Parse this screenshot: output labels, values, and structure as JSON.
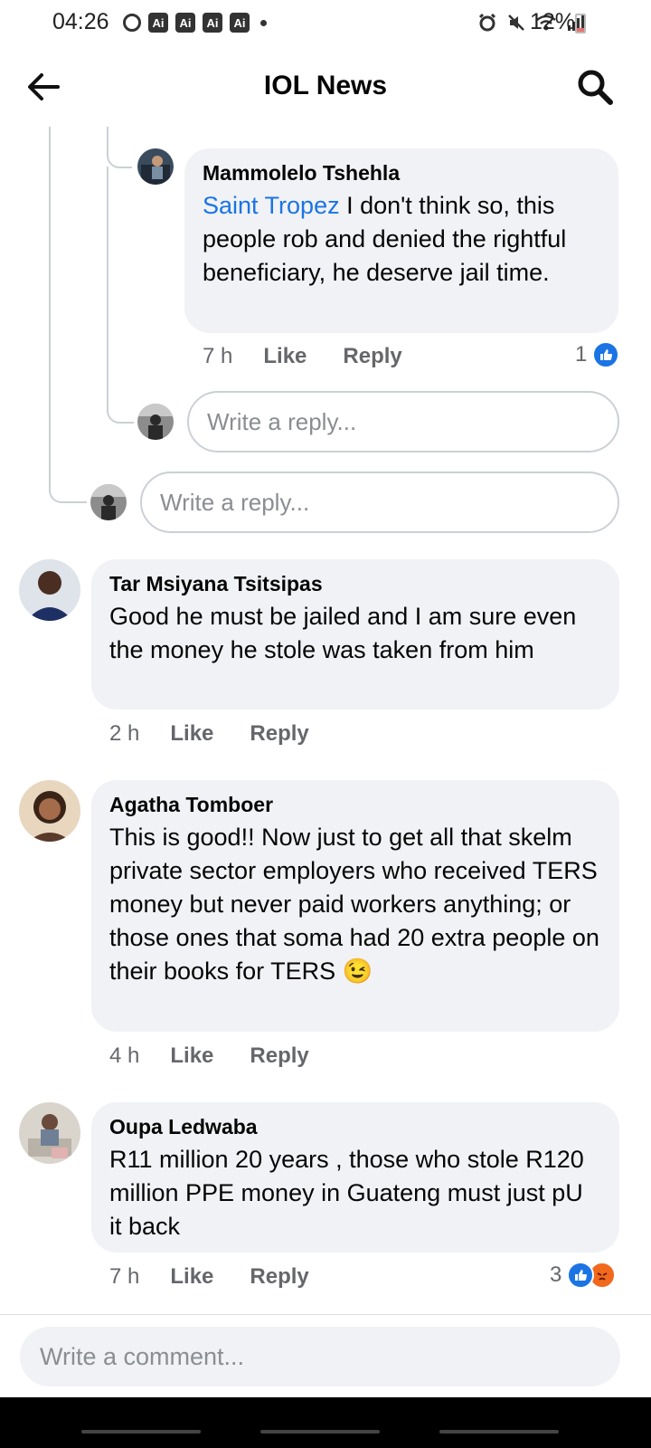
{
  "status_bar": {
    "time": "04:26",
    "ai_badges": [
      "Ai",
      "Ai",
      "Ai",
      "Ai"
    ],
    "battery": "12%"
  },
  "header": {
    "title": "IOL News"
  },
  "reply_comment": {
    "author": "Mammolelo Tshehla",
    "mention": "Saint Tropez",
    "text": " I don't think so, this people rob and denied the rightful beneficiary, he deserve jail time.",
    "time": "7 h",
    "like": "Like",
    "reply": "Reply",
    "reaction_count": "1"
  },
  "reply_inputs": {
    "nested_placeholder": "Write a reply...",
    "thread_placeholder": "Write a reply..."
  },
  "comments": [
    {
      "author": "Tar Msiyana Tsitsipas",
      "text": "Good he must be jailed and I am sure even the money he stole was taken from him",
      "time": "2 h",
      "like": "Like",
      "reply": "Reply"
    },
    {
      "author": "Agatha Tomboer",
      "text": "This is good!! Now just to get all that skelm private sector employers who received TERS money but never paid workers anything; or those ones that soma had 20 extra people on their books for TERS",
      "emoji": "😉",
      "time": "4 h",
      "like": "Like",
      "reply": "Reply"
    },
    {
      "author": "Oupa Ledwaba",
      "text": "R11 million  20 years , those who stole R120 million PPE money in Guateng must just pU it back",
      "time": "7 h",
      "like": "Like",
      "reply": "Reply",
      "reaction_count": "3"
    }
  ],
  "composer": {
    "placeholder": "Write a comment..."
  },
  "colors": {
    "link": "#1b74e4",
    "bubble": "#f0f2f5",
    "meta": "#65676b"
  }
}
